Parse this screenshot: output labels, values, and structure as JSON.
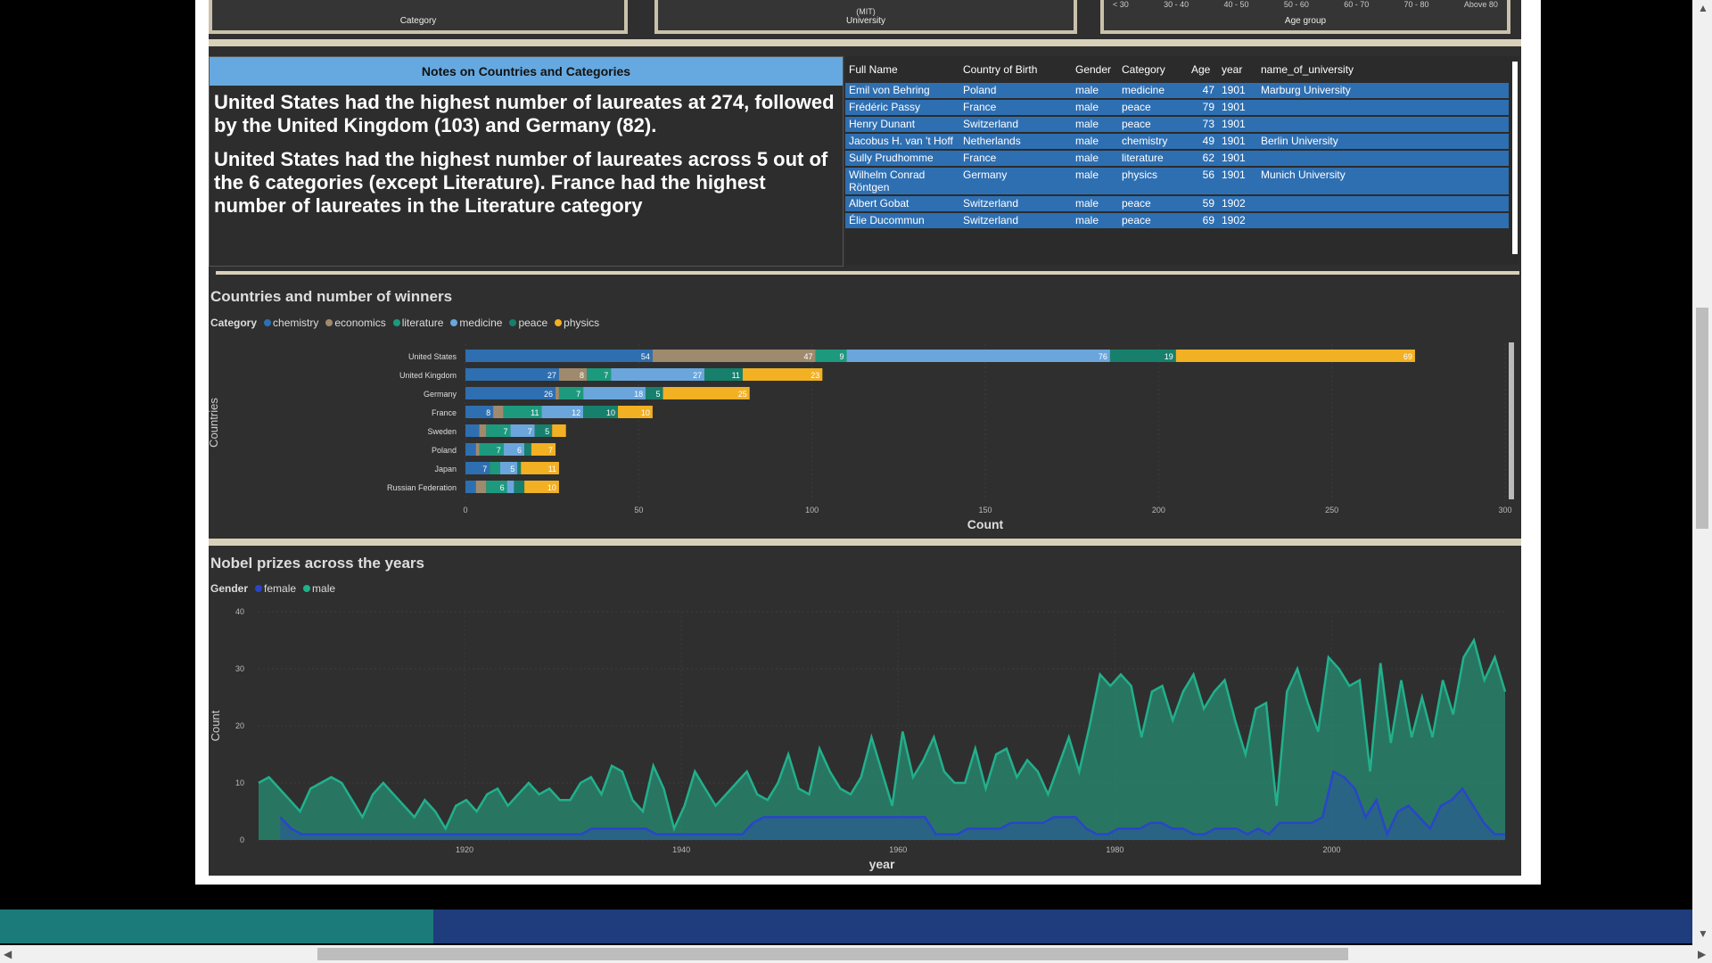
{
  "top_cards": [
    {
      "label": "Category"
    },
    {
      "label": "University",
      "sub": "(MIT)"
    },
    {
      "label": "Age group",
      "ticks": [
        "< 30",
        "30 - 40",
        "40 - 50",
        "50 - 60",
        "60 - 70",
        "70 - 80",
        "Above 80"
      ]
    }
  ],
  "notes": {
    "header": "Notes on Countries and Categories",
    "p1": "United States had the highest number of laureates at 274, followed by the United Kingdom (103) and Germany (82).",
    "p2": "United States had the highest number of laureates across 5 out of the 6 categories (except Literature). France had the highest number of laureates in the Literature category"
  },
  "table": {
    "columns": [
      "Full Name",
      "Country of Birth",
      "Gender",
      "Category",
      "Age",
      "year",
      "name_of_university"
    ],
    "rows": [
      [
        "Emil von Behring",
        "Poland",
        "male",
        "medicine",
        "47",
        "1901",
        "Marburg University"
      ],
      [
        "Frédéric Passy",
        "France",
        "male",
        "peace",
        "79",
        "1901",
        ""
      ],
      [
        "Henry Dunant",
        "Switzerland",
        "male",
        "peace",
        "73",
        "1901",
        ""
      ],
      [
        "Jacobus H. van 't Hoff",
        "Netherlands",
        "male",
        "chemistry",
        "49",
        "1901",
        "Berlin University"
      ],
      [
        "Sully Prudhomme",
        "France",
        "male",
        "literature",
        "62",
        "1901",
        ""
      ],
      [
        "Wilhelm Conrad Röntgen",
        "Germany",
        "male",
        "physics",
        "56",
        "1901",
        "Munich University"
      ],
      [
        "Albert Gobat",
        "Switzerland",
        "male",
        "peace",
        "59",
        "1902",
        ""
      ],
      [
        "Élie Ducommun",
        "Switzerland",
        "male",
        "peace",
        "69",
        "1902",
        ""
      ]
    ]
  },
  "bar_legend": {
    "title": "Category",
    "items": [
      "chemistry",
      "economics",
      "literature",
      "medicine",
      "peace",
      "physics"
    ]
  },
  "line_legend": {
    "title": "Gender",
    "items": [
      "female",
      "male"
    ]
  },
  "colors": {
    "chemistry": "#2e6fb2",
    "economics": "#a08a6e",
    "literature": "#1d9a7e",
    "medicine": "#6aa6dc",
    "peace": "#17806c",
    "physics": "#f2b023",
    "female": "#2a45c8",
    "male": "#22b08c"
  },
  "chart_data": [
    {
      "type": "bar",
      "title": "Countries and number of winners",
      "xlabel": "Count",
      "ylabel": "Countries",
      "xlim": [
        0,
        300
      ],
      "xticks": [
        0,
        50,
        100,
        150,
        200,
        250,
        300
      ],
      "categories": [
        "United States",
        "United Kingdom",
        "Germany",
        "France",
        "Sweden",
        "Poland",
        "Japan",
        "Russian Federation"
      ],
      "series": [
        {
          "name": "chemistry",
          "values": [
            54,
            27,
            26,
            8,
            4,
            3,
            7,
            3
          ]
        },
        {
          "name": "economics",
          "values": [
            47,
            8,
            1,
            3,
            2,
            1,
            0,
            3
          ]
        },
        {
          "name": "literature",
          "values": [
            9,
            7,
            7,
            11,
            7,
            7,
            3,
            6
          ]
        },
        {
          "name": "medicine",
          "values": [
            76,
            27,
            18,
            12,
            7,
            6,
            5,
            2
          ]
        },
        {
          "name": "peace",
          "values": [
            19,
            11,
            5,
            10,
            5,
            2,
            1,
            3
          ]
        },
        {
          "name": "physics",
          "values": [
            69,
            23,
            25,
            10,
            4,
            7,
            11,
            10
          ]
        }
      ],
      "data_labels": [
        [
          "54",
          "47",
          "9",
          "76",
          "19",
          "69"
        ],
        [
          "27",
          "8",
          "7",
          "27",
          "11",
          "23"
        ],
        [
          "26",
          "",
          "7",
          "18",
          "5",
          "25"
        ],
        [
          "8",
          "",
          "11",
          "12",
          "10",
          "10"
        ],
        [
          "",
          "",
          "7",
          "7",
          "5",
          ""
        ],
        [
          "",
          "",
          "7",
          "6",
          "",
          "7"
        ],
        [
          "7",
          "",
          "",
          "5",
          "",
          "11"
        ],
        [
          "",
          "",
          "6",
          "",
          "",
          "10"
        ]
      ]
    },
    {
      "type": "area",
      "title": "Nobel prizes across the years",
      "xlabel": "year",
      "ylabel": "Count",
      "ylim": [
        0,
        40
      ],
      "yticks": [
        0,
        10,
        20,
        30,
        40
      ],
      "xticks": [
        1920,
        1940,
        1960,
        1980,
        2000
      ],
      "xlim": [
        1901,
        2016
      ],
      "series": [
        {
          "name": "male",
          "x_start": 1901,
          "values": [
            10,
            11,
            9,
            7,
            5,
            9,
            10,
            11,
            10,
            7,
            4,
            8,
            10,
            8,
            6,
            4,
            7,
            5,
            2,
            6,
            7,
            5,
            8,
            9,
            6,
            8,
            10,
            8,
            9,
            7,
            7,
            10,
            11,
            8,
            13,
            12,
            7,
            5,
            13,
            9,
            2,
            6,
            12,
            9,
            6,
            8,
            10,
            12,
            8,
            7,
            10,
            15,
            9,
            8,
            16,
            12,
            9,
            8,
            11,
            18,
            12,
            6,
            19,
            11,
            14,
            18,
            12,
            10,
            10,
            16,
            9,
            15,
            16,
            11,
            14,
            12,
            8,
            13,
            18,
            12,
            20,
            29,
            27,
            29,
            27,
            18,
            26,
            27,
            21,
            26,
            29,
            23,
            26,
            28,
            21,
            15,
            23,
            24,
            6,
            26,
            30,
            24,
            19,
            32,
            30,
            27,
            28,
            12,
            31,
            17,
            28,
            18,
            25,
            18,
            28,
            22,
            32,
            35,
            28,
            32,
            26
          ]
        },
        {
          "name": "female",
          "x_start": 1903,
          "values": [
            4,
            2,
            1,
            1,
            1,
            1,
            1,
            1,
            1,
            1,
            1,
            1,
            1,
            1,
            1,
            1,
            1,
            1,
            1,
            1,
            1,
            1,
            1,
            1,
            1,
            1,
            1,
            1,
            1,
            2,
            2,
            2,
            2,
            2,
            2,
            1,
            1,
            1,
            1,
            1,
            1,
            1,
            1,
            1,
            3,
            4,
            4,
            4,
            4,
            4,
            4,
            4,
            4,
            4,
            4,
            4,
            4,
            4,
            4,
            4,
            4,
            1,
            1,
            1,
            2,
            2,
            2,
            2,
            3,
            3,
            3,
            3,
            4,
            4,
            4,
            2,
            1,
            1,
            2,
            2,
            2,
            3,
            3,
            2,
            2,
            1,
            1,
            2,
            2,
            2,
            1,
            2,
            1,
            3,
            3,
            3,
            3,
            4,
            12,
            11,
            9,
            4,
            7,
            1,
            5,
            6,
            4,
            2,
            6,
            7,
            9,
            6,
            3,
            1,
            1
          ]
        }
      ]
    }
  ]
}
